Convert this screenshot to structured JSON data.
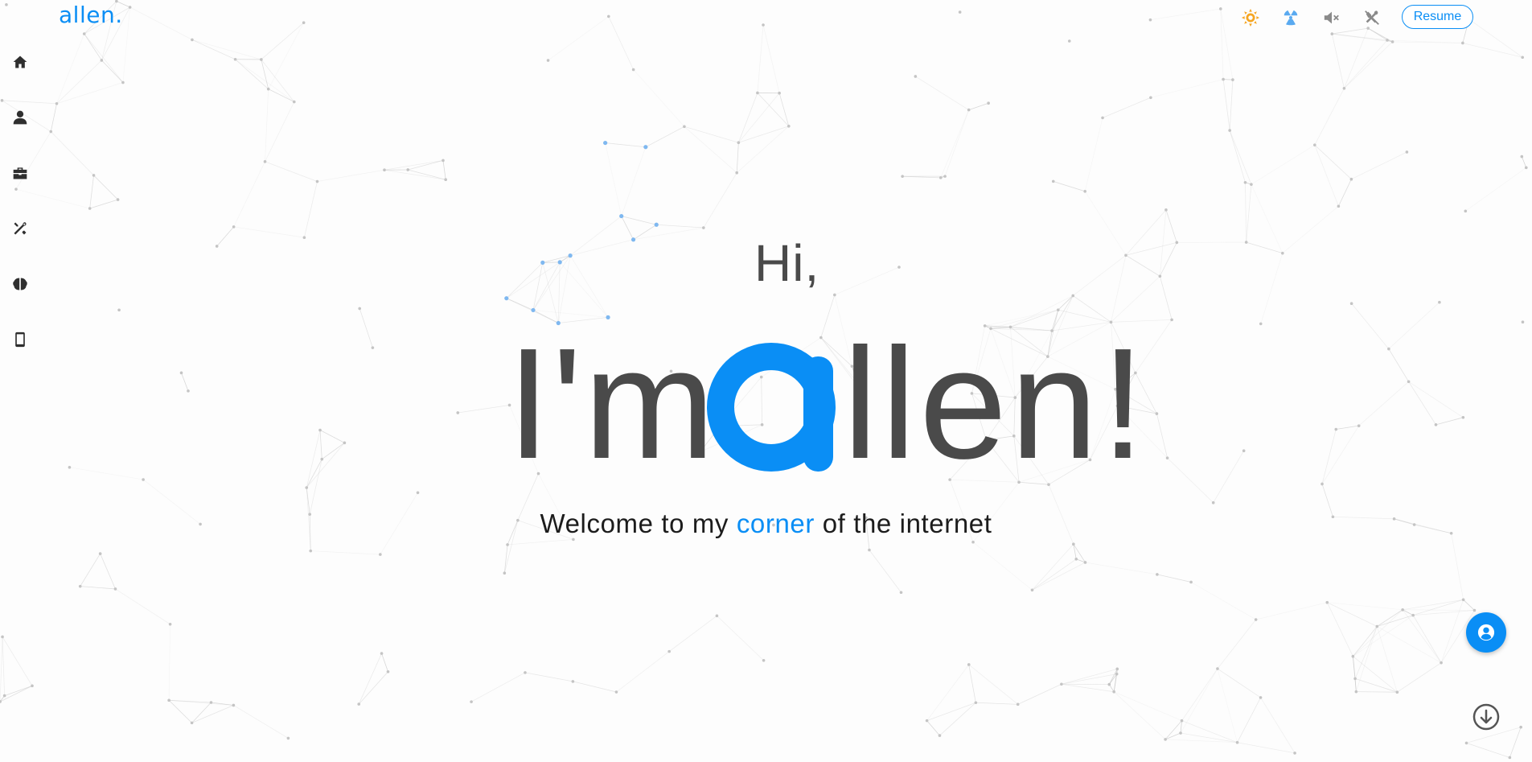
{
  "header": {
    "logo_text": "allen.",
    "resume_label": "Resume"
  },
  "toolbar_icons": [
    "theme-sun-icon",
    "radiation-icon",
    "sound-muted-icon",
    "tools-off-icon"
  ],
  "sidebar": {
    "items": [
      {
        "icon": "home-icon"
      },
      {
        "icon": "user-icon"
      },
      {
        "icon": "briefcase-icon"
      },
      {
        "icon": "tools-icon"
      },
      {
        "icon": "brain-icon"
      },
      {
        "icon": "mobile-icon"
      }
    ]
  },
  "hero": {
    "greeting": "Hi,",
    "im": "I'm",
    "name_initial": "a",
    "name_rest": "llen!",
    "welcome_prefix": "Welcome to my ",
    "welcome_accent": "corner",
    "welcome_suffix": " of the internet"
  },
  "colors": {
    "accent": "#0a8ef5",
    "text_dark": "#4a4a4a",
    "icon_dark": "#2f2f2f",
    "sun": "#f5a623"
  }
}
